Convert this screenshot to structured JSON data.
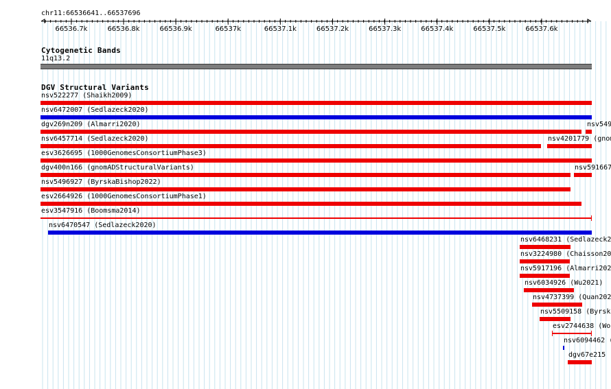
{
  "location": "chr11:66536641..66537696",
  "ruler": {
    "ticks": [
      {
        "label": "66536.7k",
        "pos": 66536700
      },
      {
        "label": "66536.8k",
        "pos": 66536800
      },
      {
        "label": "66536.9k",
        "pos": 66536900
      },
      {
        "label": "66537k",
        "pos": 66537000
      },
      {
        "label": "66537.1k",
        "pos": 66537100
      },
      {
        "label": "66537.2k",
        "pos": 66537200
      },
      {
        "label": "66537.3k",
        "pos": 66537300
      },
      {
        "label": "66537.4k",
        "pos": 66537400
      },
      {
        "label": "66537.5k",
        "pos": 66537500
      },
      {
        "label": "66537.6k",
        "pos": 66537600
      }
    ]
  },
  "tracks": {
    "cytobands": {
      "title": "Cytogenetic Bands",
      "band": "11q13.2"
    },
    "dgv": {
      "title": "DGV Structural Variants"
    }
  },
  "colors": {
    "loss": "#ee0000",
    "gain": "#0000dd",
    "band": "#7d7d7d",
    "grid": "#c8e4ee"
  },
  "features": [
    {
      "label": "nsv522277 (Shaikh2009)",
      "type": "loss"
    },
    {
      "label": "nsv6472007 (Sedlazeck2020)",
      "type": "gain"
    },
    {
      "label": "dgv269n209 (Almarri2020)",
      "type": "loss"
    },
    {
      "label": "nsv549",
      "type": "loss"
    },
    {
      "label": "nsv6457714 (Sedlazeck2020)",
      "type": "loss"
    },
    {
      "label": "nsv4201779 (gnom",
      "type": "loss"
    },
    {
      "label": "esv3626695 (1000GenomesConsortiumPhase3)",
      "type": "loss"
    },
    {
      "label": "dgv400n166 (gnomADStructuralVariants)",
      "type": "loss"
    },
    {
      "label": "nsv591667",
      "type": "loss"
    },
    {
      "label": "nsv5496927 (ByrskaBishop2022)",
      "type": "loss"
    },
    {
      "label": "esv2664926 (1000GenomesConsortiumPhase1)",
      "type": "loss"
    },
    {
      "label": "esv3547916 (Boomsma2014)",
      "type": "loss"
    },
    {
      "label": "nsv6470547 (Sedlazeck2020)",
      "type": "gain"
    },
    {
      "label": "nsv6468231 (Sedlazeck2",
      "type": "loss"
    },
    {
      "label": "nsv3224980 (Chaisson20",
      "type": "loss"
    },
    {
      "label": "nsv5917196 (Almarri202",
      "type": "loss"
    },
    {
      "label": "nsv6034926 (Wu2021)",
      "type": "loss"
    },
    {
      "label": "nsv4737399 (Quan202",
      "type": "loss"
    },
    {
      "label": "nsv5509158 (Byrsk",
      "type": "loss"
    },
    {
      "label": "esv2744638 (Wor",
      "type": "loss"
    },
    {
      "label": "nsv6094462 (",
      "type": "gain"
    },
    {
      "label": "dgv67e215",
      "type": "loss"
    }
  ]
}
